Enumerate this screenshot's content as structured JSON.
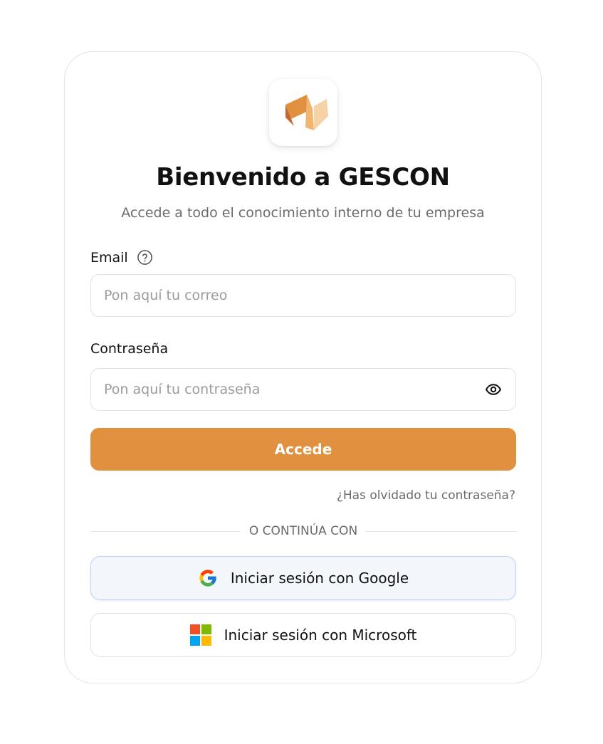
{
  "header": {
    "title": "Bienvenido a GESCON",
    "subtitle": "Accede a todo el conocimiento interno de tu empresa",
    "logo_icon": "gescon-logo-icon"
  },
  "form": {
    "email": {
      "label": "Email",
      "help_icon": "question-circle-icon",
      "placeholder": "Pon aquí tu correo",
      "value": ""
    },
    "password": {
      "label": "Contraseña",
      "placeholder": "Pon aquí tu contraseña",
      "value": "",
      "toggle_icon": "eye-icon"
    },
    "submit_label": "Accede",
    "forgot_label": "¿Has olvidado tu contraseña?"
  },
  "divider_label": "O CONTINÚA CON",
  "sso": {
    "google_label": "Iniciar sesión con Google",
    "google_icon": "google-icon",
    "microsoft_label": "Iniciar sesión con Microsoft",
    "microsoft_icon": "microsoft-icon"
  },
  "colors": {
    "accent": "#e0903f",
    "google_bg": "#f3f7fc",
    "google_border": "#b9d3f3"
  }
}
